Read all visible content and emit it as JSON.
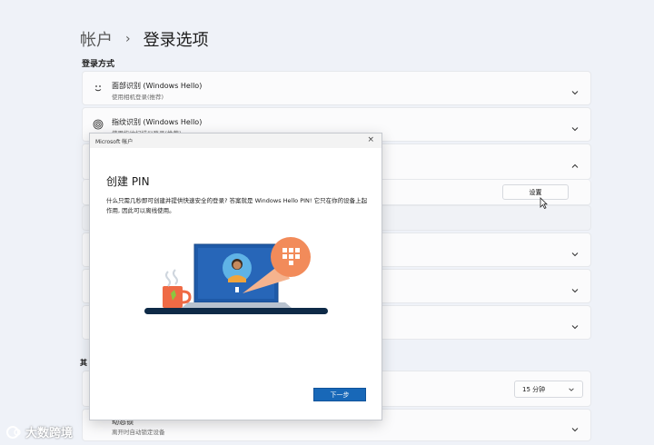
{
  "breadcrumb": {
    "parent": "帐户",
    "separator": "›",
    "current": "登录选项"
  },
  "section_title": "登录方式",
  "cards": [
    {
      "title": "面部识别 (Windows Hello)",
      "subtitle": "使用相机登录(推荐)",
      "icon": "face-icon"
    },
    {
      "title": "指纹识别 (Windows Hello)",
      "subtitle": "使用指纹扫描仪登录(推荐)",
      "icon": "fingerprint-icon"
    }
  ],
  "setup_button": "设置",
  "other_settings_label": "其",
  "lock_select": {
    "value": "15 分钟"
  },
  "dynamic_lock": {
    "title": "动态锁",
    "subtitle": "离开时自动锁定设备"
  },
  "dialog": {
    "title": "Microsoft 帐户",
    "close": "×",
    "heading": "创建 PIN",
    "body": "什么只需几秒即可创建并提供快速安全的登录? 答案就是 Windows Hello PIN! 它只在你的设备上起作用, 因此可以离线使用。",
    "next_button": "下一步"
  },
  "watermark": "大数跨境",
  "colors": {
    "accent": "#1868b8",
    "page_bg": "#eff2f8",
    "pin_bubble": "#f28b5a"
  }
}
